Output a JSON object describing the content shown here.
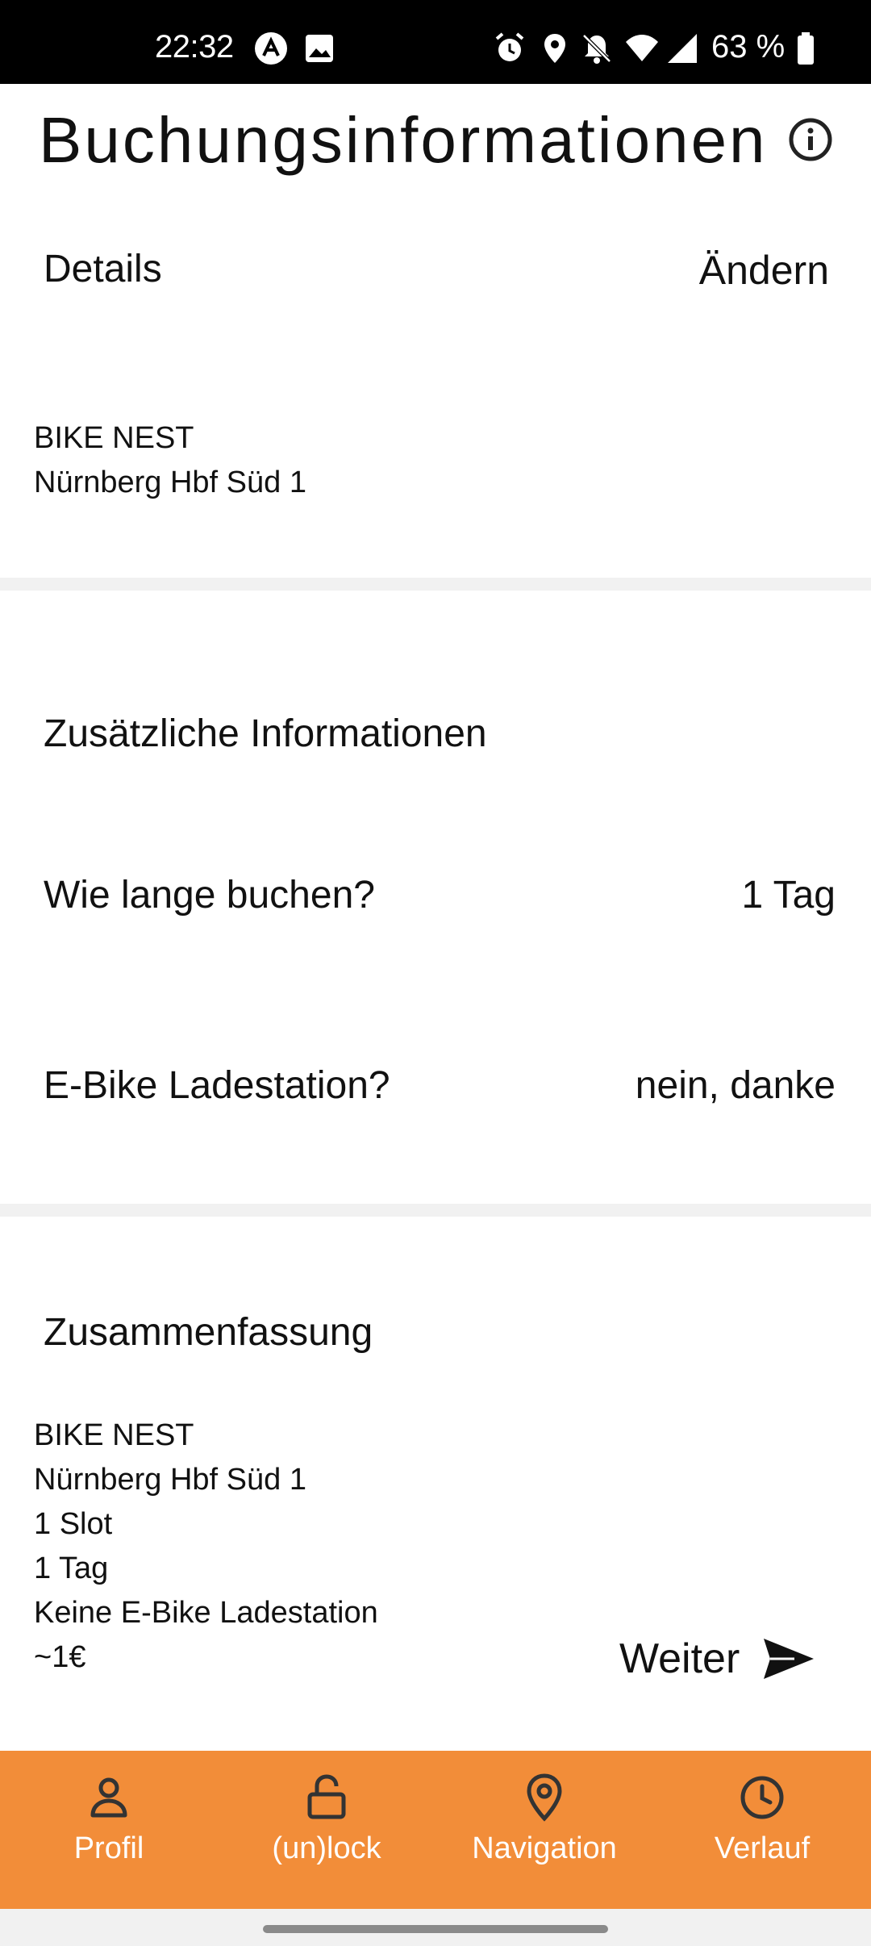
{
  "status_bar": {
    "time": "22:32",
    "battery": "63 %",
    "icons": [
      "app-a-icon",
      "image-icon",
      "alarm-icon",
      "location-icon",
      "bell-off-icon",
      "wifi-icon",
      "signal-icon",
      "battery-icon"
    ]
  },
  "header": {
    "title": "Buchungsinformationen",
    "info_icon": "info-icon"
  },
  "details": {
    "heading": "Details",
    "change_label": "Ändern",
    "station_name": "BIKE NEST",
    "station_location": "Nürnberg Hbf Süd 1"
  },
  "additional": {
    "heading": "Zusätzliche Informationen",
    "duration_label": "Wie lange buchen?",
    "duration_value": "1 Tag",
    "charging_label": "E-Bike Ladestation?",
    "charging_value": "nein, danke"
  },
  "summary": {
    "heading": "Zusammenfassung",
    "lines": [
      "BIKE NEST",
      "Nürnberg Hbf Süd 1",
      "1 Slot",
      "1 Tag",
      "Keine E-Bike Ladestation",
      "~1€"
    ],
    "next_label": "Weiter"
  },
  "bottom_nav": {
    "background": "#f28d39",
    "items": [
      {
        "label": "Profil",
        "icon": "person-icon"
      },
      {
        "label": "(un)lock",
        "icon": "lock-icon"
      },
      {
        "label": "Navigation",
        "icon": "location-pin-icon"
      },
      {
        "label": "Verlauf",
        "icon": "clock-icon"
      }
    ]
  }
}
